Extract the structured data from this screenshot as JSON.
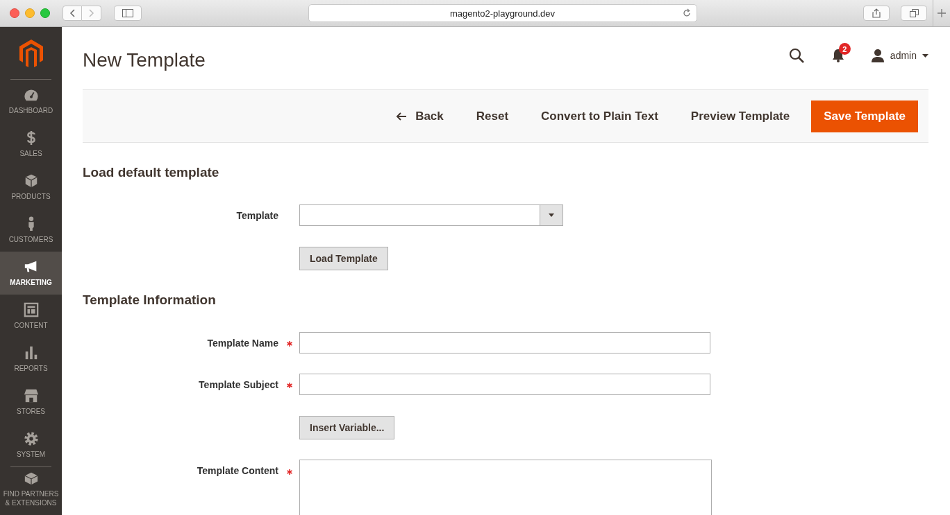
{
  "browser": {
    "url": "magento2-playground.dev"
  },
  "sidebar": {
    "items": [
      {
        "label": "DASHBOARD",
        "kind": "gauge",
        "selected": false
      },
      {
        "label": "SALES",
        "kind": "dollar",
        "selected": false
      },
      {
        "label": "PRODUCTS",
        "kind": "box",
        "selected": false
      },
      {
        "label": "CUSTOMERS",
        "kind": "person",
        "selected": false
      },
      {
        "label": "MARKETING",
        "kind": "megaphone",
        "selected": true
      },
      {
        "label": "CONTENT",
        "kind": "layout",
        "selected": false
      },
      {
        "label": "REPORTS",
        "kind": "bars",
        "selected": false
      },
      {
        "label": "STORES",
        "kind": "store",
        "selected": false
      },
      {
        "label": "SYSTEM",
        "kind": "gear",
        "selected": false
      },
      {
        "label": "FIND PARTNERS & EXTENSIONS",
        "kind": "blocks",
        "selected": false
      }
    ]
  },
  "header": {
    "title": "New Template",
    "notifications": "2",
    "user": "admin"
  },
  "actions": [
    {
      "label": "Back",
      "kind": "back"
    },
    {
      "label": "Reset",
      "kind": "plain"
    },
    {
      "label": "Convert to Plain Text",
      "kind": "plain"
    },
    {
      "label": "Preview Template",
      "kind": "plain"
    },
    {
      "label": "Save Template",
      "kind": "primary"
    }
  ],
  "sections": [
    {
      "title": "Load default template",
      "fields": [
        {
          "kind": "select",
          "label": "Template",
          "required": false
        },
        {
          "kind": "button",
          "label": "Load Template"
        }
      ]
    },
    {
      "title": "Template Information",
      "fields": [
        {
          "kind": "text",
          "label": "Template Name",
          "required": true
        },
        {
          "kind": "text",
          "label": "Template Subject",
          "required": true
        },
        {
          "kind": "button",
          "label": "Insert Variable..."
        },
        {
          "kind": "textarea",
          "label": "Template Content",
          "required": true
        }
      ]
    }
  ]
}
